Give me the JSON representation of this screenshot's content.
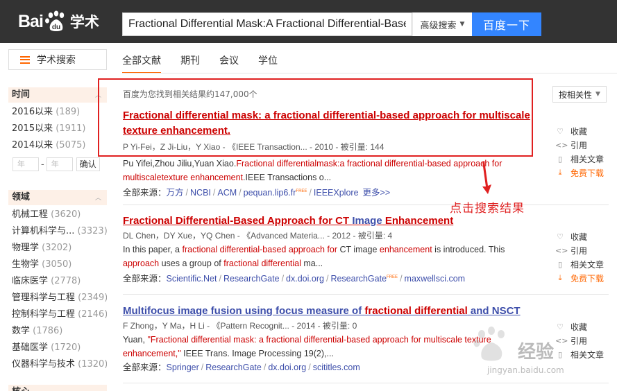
{
  "header": {
    "logo_text": "Bai",
    "logo_text2": "du",
    "logo_xueshu": "学术",
    "search_value": "Fractional Differential Mask:A Fractional Differential-Base",
    "advanced_search": "高级搜索",
    "search_button": "百度一下"
  },
  "nav_button": "学术搜索",
  "tabs": [
    "全部文献",
    "期刊",
    "会议",
    "学位"
  ],
  "sidebar": {
    "time_title": "时间",
    "years": [
      {
        "label": "2016以来",
        "count": "(189)"
      },
      {
        "label": "2015以来",
        "count": "(1911)"
      },
      {
        "label": "2014以来",
        "count": "(5075)"
      }
    ],
    "year_from_placeholder": "年",
    "year_to_placeholder": "年",
    "year_dash": "-",
    "confirm": "确认",
    "field_title": "领域",
    "fields": [
      {
        "label": "机械工程",
        "count": "(3620)"
      },
      {
        "label": "计算机科学与...",
        "count": "(3323)"
      },
      {
        "label": "物理学",
        "count": "(3202)"
      },
      {
        "label": "生物学",
        "count": "(3050)"
      },
      {
        "label": "临床医学",
        "count": "(2778)"
      },
      {
        "label": "管理科学与工程",
        "count": "(2349)"
      },
      {
        "label": "控制科学与工程",
        "count": "(2146)"
      },
      {
        "label": "数学",
        "count": "(1786)"
      },
      {
        "label": "基础医学",
        "count": "(1720)"
      },
      {
        "label": "仪器科学与技术",
        "count": "(1320)"
      }
    ],
    "next_title": "核心"
  },
  "result_count": "百度为您找到相关结果约147,000个",
  "sort": "按相关性",
  "results": [
    {
      "title_line1": "Fractional differential mask: a fractional differential-based approach for multiscale",
      "title_line2": "texture enhancement.",
      "meta": "P Yi-Fei，Z Ji-Liu，Y Xiao - 《IEEE Transaction... - 2010 - 被引量: 144",
      "abs1_a": "Pu Yifei,Zhou Jiliu,Yuan Xiao.",
      "abs1_b": "Fractional differentialmask:a fractional differential-based approach for",
      "abs2_a": "multiscaletexture enhancement",
      "abs2_b": ".IEEE Transactions o...",
      "src_label": "全部来源：",
      "sources": [
        "万方",
        "NCBI",
        "ACM",
        "pequan.lip6.fr",
        "IEEEXplore"
      ],
      "free": "FREE",
      "more": "更多>>"
    },
    {
      "title_a": "Fractional Differential-Based Approach for CT ",
      "title_b": "Image",
      "title_c": " Enhancement",
      "meta": "DL Chen，DY Xue，YQ Chen - 《Advanced Materia... - 2012 - 被引量: 4",
      "abs1_a": "In this paper, a ",
      "abs1_b": "fractional differential-based approach for",
      "abs1_c": " CT image ",
      "abs1_d": "enhancement",
      "abs1_e": " is introduced. This",
      "abs2_a": "approach",
      "abs2_b": " uses a group of ",
      "abs2_c": "fractional differential",
      "abs2_d": " ma...",
      "src_label": "全部来源：",
      "sources": [
        "Scientific.Net",
        "ResearchGate",
        "dx.doi.org",
        "ResearchGate",
        "maxwellsci.com"
      ],
      "free": "FREE"
    },
    {
      "title_a": "Multifocus image fusion using focus measure of ",
      "title_b": "fractional differential",
      "title_c": " and NSCT",
      "meta": "F Zhong，Y Ma，H Li - 《Pattern Recognit... - 2014 - 被引量: 0",
      "abs1_a": "Yuan, ",
      "abs1_b": "\"Fractional differential mask: a fractional differential-based approach for multiscale texture",
      "abs2_a": "enhancement,\"",
      "abs2_b": " IEEE Trans. Image Processing 19(2),...",
      "src_label": "全部来源：",
      "sources": [
        "Springer",
        "ResearchGate",
        "dx.doi.org",
        "scititles.com"
      ]
    }
  ],
  "actions": {
    "collect": "收藏",
    "cite": "引用",
    "related": "相关文章",
    "download": "免费下载"
  },
  "annotation": "点击搜索结果",
  "watermark": "经验",
  "watermark_sub": "jingyan.baidu.com",
  "colors": {
    "header_bg": "#333333",
    "search_btn": "#3385ff",
    "accent_orange": "#ff6600",
    "link_blue": "#3d4eaa",
    "highlight_red": "#cc0000",
    "annotation_red": "#e02020"
  }
}
